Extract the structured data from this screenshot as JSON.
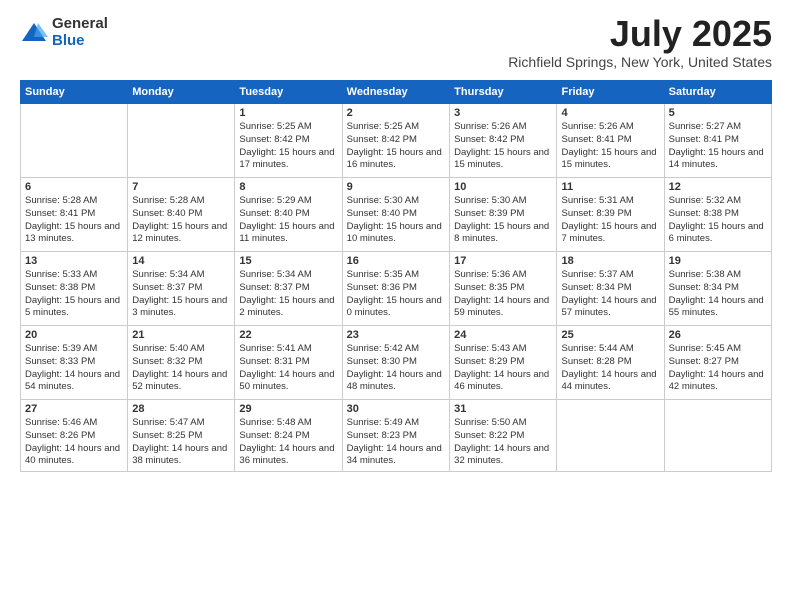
{
  "logo": {
    "general": "General",
    "blue": "Blue"
  },
  "title": {
    "month_year": "July 2025",
    "location": "Richfield Springs, New York, United States"
  },
  "days_of_week": [
    "Sunday",
    "Monday",
    "Tuesday",
    "Wednesday",
    "Thursday",
    "Friday",
    "Saturday"
  ],
  "weeks": [
    [
      {
        "day": "",
        "sunrise": "",
        "sunset": "",
        "daylight": ""
      },
      {
        "day": "",
        "sunrise": "",
        "sunset": "",
        "daylight": ""
      },
      {
        "day": "1",
        "sunrise": "Sunrise: 5:25 AM",
        "sunset": "Sunset: 8:42 PM",
        "daylight": "Daylight: 15 hours and 17 minutes."
      },
      {
        "day": "2",
        "sunrise": "Sunrise: 5:25 AM",
        "sunset": "Sunset: 8:42 PM",
        "daylight": "Daylight: 15 hours and 16 minutes."
      },
      {
        "day": "3",
        "sunrise": "Sunrise: 5:26 AM",
        "sunset": "Sunset: 8:42 PM",
        "daylight": "Daylight: 15 hours and 15 minutes."
      },
      {
        "day": "4",
        "sunrise": "Sunrise: 5:26 AM",
        "sunset": "Sunset: 8:41 PM",
        "daylight": "Daylight: 15 hours and 15 minutes."
      },
      {
        "day": "5",
        "sunrise": "Sunrise: 5:27 AM",
        "sunset": "Sunset: 8:41 PM",
        "daylight": "Daylight: 15 hours and 14 minutes."
      }
    ],
    [
      {
        "day": "6",
        "sunrise": "Sunrise: 5:28 AM",
        "sunset": "Sunset: 8:41 PM",
        "daylight": "Daylight: 15 hours and 13 minutes."
      },
      {
        "day": "7",
        "sunrise": "Sunrise: 5:28 AM",
        "sunset": "Sunset: 8:40 PM",
        "daylight": "Daylight: 15 hours and 12 minutes."
      },
      {
        "day": "8",
        "sunrise": "Sunrise: 5:29 AM",
        "sunset": "Sunset: 8:40 PM",
        "daylight": "Daylight: 15 hours and 11 minutes."
      },
      {
        "day": "9",
        "sunrise": "Sunrise: 5:30 AM",
        "sunset": "Sunset: 8:40 PM",
        "daylight": "Daylight: 15 hours and 10 minutes."
      },
      {
        "day": "10",
        "sunrise": "Sunrise: 5:30 AM",
        "sunset": "Sunset: 8:39 PM",
        "daylight": "Daylight: 15 hours and 8 minutes."
      },
      {
        "day": "11",
        "sunrise": "Sunrise: 5:31 AM",
        "sunset": "Sunset: 8:39 PM",
        "daylight": "Daylight: 15 hours and 7 minutes."
      },
      {
        "day": "12",
        "sunrise": "Sunrise: 5:32 AM",
        "sunset": "Sunset: 8:38 PM",
        "daylight": "Daylight: 15 hours and 6 minutes."
      }
    ],
    [
      {
        "day": "13",
        "sunrise": "Sunrise: 5:33 AM",
        "sunset": "Sunset: 8:38 PM",
        "daylight": "Daylight: 15 hours and 5 minutes."
      },
      {
        "day": "14",
        "sunrise": "Sunrise: 5:34 AM",
        "sunset": "Sunset: 8:37 PM",
        "daylight": "Daylight: 15 hours and 3 minutes."
      },
      {
        "day": "15",
        "sunrise": "Sunrise: 5:34 AM",
        "sunset": "Sunset: 8:37 PM",
        "daylight": "Daylight: 15 hours and 2 minutes."
      },
      {
        "day": "16",
        "sunrise": "Sunrise: 5:35 AM",
        "sunset": "Sunset: 8:36 PM",
        "daylight": "Daylight: 15 hours and 0 minutes."
      },
      {
        "day": "17",
        "sunrise": "Sunrise: 5:36 AM",
        "sunset": "Sunset: 8:35 PM",
        "daylight": "Daylight: 14 hours and 59 minutes."
      },
      {
        "day": "18",
        "sunrise": "Sunrise: 5:37 AM",
        "sunset": "Sunset: 8:34 PM",
        "daylight": "Daylight: 14 hours and 57 minutes."
      },
      {
        "day": "19",
        "sunrise": "Sunrise: 5:38 AM",
        "sunset": "Sunset: 8:34 PM",
        "daylight": "Daylight: 14 hours and 55 minutes."
      }
    ],
    [
      {
        "day": "20",
        "sunrise": "Sunrise: 5:39 AM",
        "sunset": "Sunset: 8:33 PM",
        "daylight": "Daylight: 14 hours and 54 minutes."
      },
      {
        "day": "21",
        "sunrise": "Sunrise: 5:40 AM",
        "sunset": "Sunset: 8:32 PM",
        "daylight": "Daylight: 14 hours and 52 minutes."
      },
      {
        "day": "22",
        "sunrise": "Sunrise: 5:41 AM",
        "sunset": "Sunset: 8:31 PM",
        "daylight": "Daylight: 14 hours and 50 minutes."
      },
      {
        "day": "23",
        "sunrise": "Sunrise: 5:42 AM",
        "sunset": "Sunset: 8:30 PM",
        "daylight": "Daylight: 14 hours and 48 minutes."
      },
      {
        "day": "24",
        "sunrise": "Sunrise: 5:43 AM",
        "sunset": "Sunset: 8:29 PM",
        "daylight": "Daylight: 14 hours and 46 minutes."
      },
      {
        "day": "25",
        "sunrise": "Sunrise: 5:44 AM",
        "sunset": "Sunset: 8:28 PM",
        "daylight": "Daylight: 14 hours and 44 minutes."
      },
      {
        "day": "26",
        "sunrise": "Sunrise: 5:45 AM",
        "sunset": "Sunset: 8:27 PM",
        "daylight": "Daylight: 14 hours and 42 minutes."
      }
    ],
    [
      {
        "day": "27",
        "sunrise": "Sunrise: 5:46 AM",
        "sunset": "Sunset: 8:26 PM",
        "daylight": "Daylight: 14 hours and 40 minutes."
      },
      {
        "day": "28",
        "sunrise": "Sunrise: 5:47 AM",
        "sunset": "Sunset: 8:25 PM",
        "daylight": "Daylight: 14 hours and 38 minutes."
      },
      {
        "day": "29",
        "sunrise": "Sunrise: 5:48 AM",
        "sunset": "Sunset: 8:24 PM",
        "daylight": "Daylight: 14 hours and 36 minutes."
      },
      {
        "day": "30",
        "sunrise": "Sunrise: 5:49 AM",
        "sunset": "Sunset: 8:23 PM",
        "daylight": "Daylight: 14 hours and 34 minutes."
      },
      {
        "day": "31",
        "sunrise": "Sunrise: 5:50 AM",
        "sunset": "Sunset: 8:22 PM",
        "daylight": "Daylight: 14 hours and 32 minutes."
      },
      {
        "day": "",
        "sunrise": "",
        "sunset": "",
        "daylight": ""
      },
      {
        "day": "",
        "sunrise": "",
        "sunset": "",
        "daylight": ""
      }
    ]
  ]
}
